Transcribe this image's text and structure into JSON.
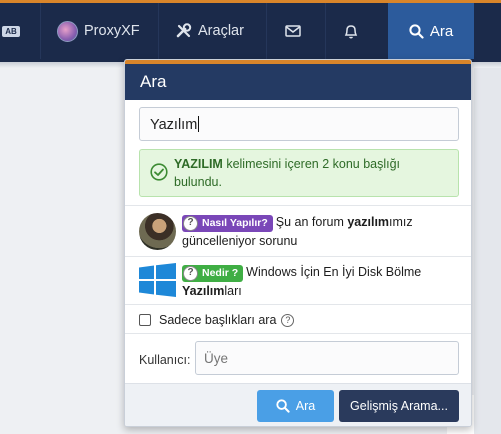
{
  "nav": {
    "brand_label": "AB",
    "user_label": "ProxyXF",
    "tools_label": "Araçlar",
    "search_label": "Ara"
  },
  "panel": {
    "title": "Ara",
    "search_value": "Yazılım",
    "result": {
      "keyword": "YAZILIM",
      "message": " kelimesini içeren 2 konu başlığı bulundu."
    },
    "threads": [
      {
        "prefix": "Nasıl Yapılır?",
        "prefix_color": "#7a47b8",
        "text_before": "Şu an forum ",
        "highlight": "yazılım",
        "text_after": "ımız güncelleniyor sorunu"
      },
      {
        "prefix": "Nedir ?",
        "prefix_color": "#3fae44",
        "text_before": "Windows İçin En İyi Disk Bölme ",
        "highlight": "Yazılım",
        "text_after": "ları"
      }
    ],
    "titles_only_label": "Sadece başlıkları ara",
    "user_label": "Kullanıcı:",
    "user_placeholder": "Üye",
    "search_button": "Ara",
    "advanced_button": "Gelişmiş Arama..."
  },
  "icons": [
    "brand-icon",
    "tools-icon",
    "mail-icon",
    "bell-icon",
    "search-icon",
    "check-circle-icon",
    "question-icon",
    "windows-logo-icon",
    "help-icon"
  ],
  "colors": {
    "nav_bg": "#1b2a4a",
    "accent": "#d9852a",
    "panel_header": "#243a63",
    "success_bg": "#e5f6df",
    "search_button": "#4a9fe6",
    "advanced_button": "#2a3a5c"
  }
}
